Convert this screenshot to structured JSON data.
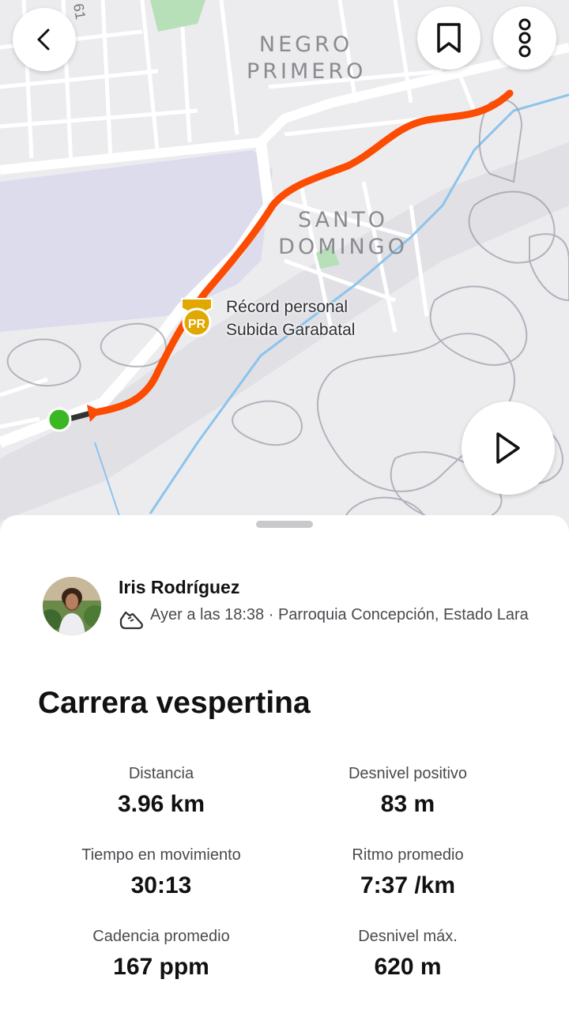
{
  "map": {
    "labels": {
      "neighborhood_1_line1": "NEGRO",
      "neighborhood_1_line2": "PRIMERO",
      "neighborhood_2_line1": "SANTO",
      "neighborhood_2_line2": "DOMINGO",
      "road_number": "61"
    },
    "personal_record": {
      "badge_text": "PR",
      "line1": "Récord personal",
      "line2": "Subida Garabatal"
    },
    "route_color": "#fc4c02",
    "start_color": "#3cb724",
    "icons": {
      "back": "chevron-left-icon",
      "bookmark": "bookmark-icon",
      "more": "vertical-dots-icon",
      "play": "play-icon"
    }
  },
  "activity": {
    "athlete_name": "Iris Rodríguez",
    "sport_icon": "running-shoe-icon",
    "meta": "Ayer a las 18:38 · Parroquia Concepción, Estado Lara",
    "title": "Carrera vespertina"
  },
  "stats": [
    {
      "label": "Distancia",
      "value": "3.96 km"
    },
    {
      "label": "Desnivel positivo",
      "value": "83 m"
    },
    {
      "label": "Tiempo en movimiento",
      "value": "30:13"
    },
    {
      "label": "Ritmo promedio",
      "value": "7:37 /km"
    },
    {
      "label": "Cadencia promedio",
      "value": "167 ppm"
    },
    {
      "label": "Desnivel máx.",
      "value": "620 m"
    }
  ]
}
